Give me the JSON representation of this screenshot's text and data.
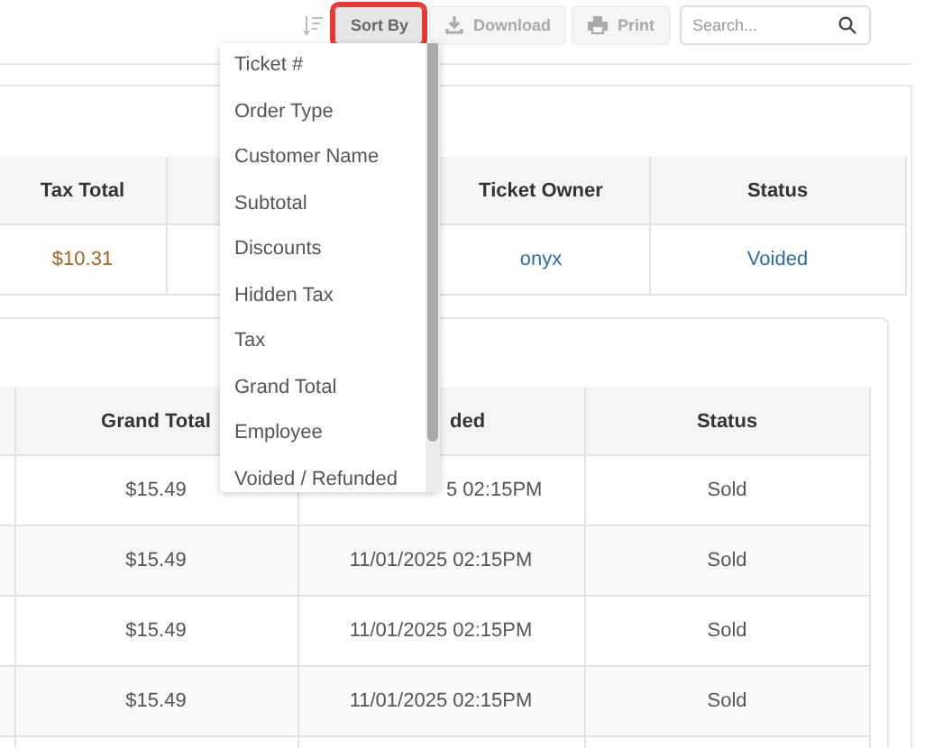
{
  "toolbar": {
    "buttons": [
      {
        "kind": "sort",
        "label": "Sort By",
        "highlighted": true,
        "disabled": false
      },
      {
        "kind": "download",
        "label": "Download",
        "highlighted": false,
        "disabled": true
      },
      {
        "kind": "print",
        "label": "Print",
        "highlighted": false,
        "disabled": true
      }
    ],
    "search": {
      "placeholder": "Search..."
    }
  },
  "sort_menu": {
    "items": [
      "Ticket #",
      "Order Type",
      "Customer Name",
      "Subtotal",
      "Discounts",
      "Hidden Tax",
      "Tax",
      "Grand Total",
      "Employee",
      "Voided / Refunded"
    ]
  },
  "summary_table": {
    "columns": [
      "Tax Total",
      null,
      "Ticket Owner",
      "Status"
    ],
    "rows": [
      [
        "$10.31",
        null,
        "onyx",
        "Voided"
      ]
    ]
  },
  "items_table": {
    "columns": [
      null,
      "Grand Total",
      "ded",
      "Status"
    ],
    "rows": [
      [
        null,
        "$15.49",
        "5 02:15PM",
        "Sold"
      ],
      [
        null,
        "$15.49",
        "11/01/2025 02:15PM",
        "Sold"
      ],
      [
        null,
        "$15.49",
        "11/01/2025 02:15PM",
        "Sold"
      ],
      [
        null,
        "$15.49",
        "11/01/2025 02:15PM",
        "Sold"
      ]
    ]
  }
}
